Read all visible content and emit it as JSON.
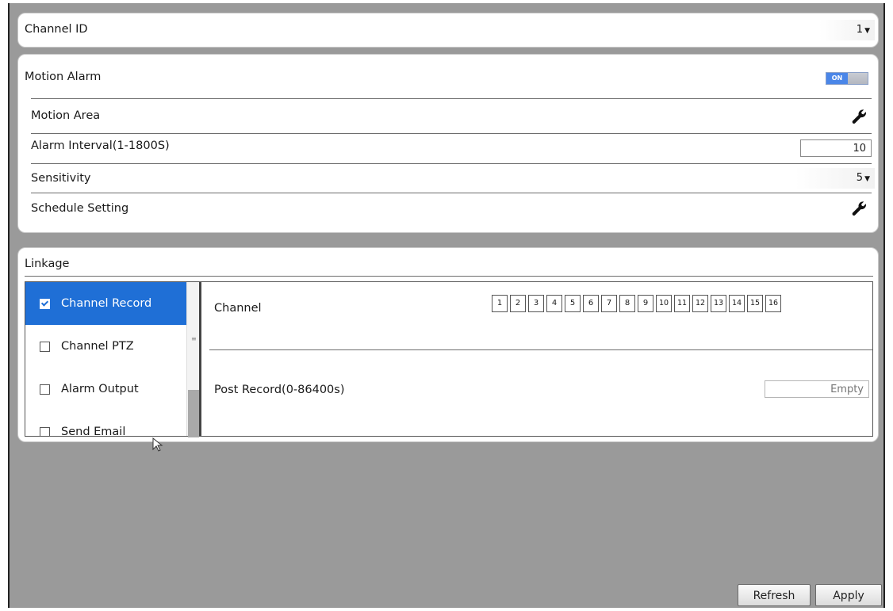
{
  "channel_id": {
    "label": "Channel ID",
    "value": "1"
  },
  "motion_alarm": {
    "label": "Motion Alarm",
    "toggle_text": "ON",
    "rows": {
      "motion_area": "Motion Area",
      "alarm_interval": {
        "label": "Alarm Interval(1-1800S)",
        "value": "10"
      },
      "sensitivity": {
        "label": "Sensitivity",
        "value": "5"
      },
      "schedule": "Schedule Setting"
    }
  },
  "linkage": {
    "label": "Linkage",
    "items": [
      {
        "label": "Channel Record",
        "checked": true
      },
      {
        "label": "Channel PTZ",
        "checked": false
      },
      {
        "label": "Alarm Output",
        "checked": false
      },
      {
        "label": "Send Email",
        "checked": false
      }
    ],
    "channel_label": "Channel",
    "channels": [
      "1",
      "2",
      "3",
      "4",
      "5",
      "6",
      "7",
      "8",
      "9",
      "10",
      "11",
      "12",
      "13",
      "14",
      "15",
      "16"
    ],
    "post_record": {
      "label": "Post Record(0-86400s)",
      "placeholder": "Empty"
    }
  },
  "buttons": {
    "refresh": "Refresh",
    "apply": "Apply"
  },
  "colors": {
    "accent": "#1f6fd6",
    "frame": "#9a9a9a"
  }
}
